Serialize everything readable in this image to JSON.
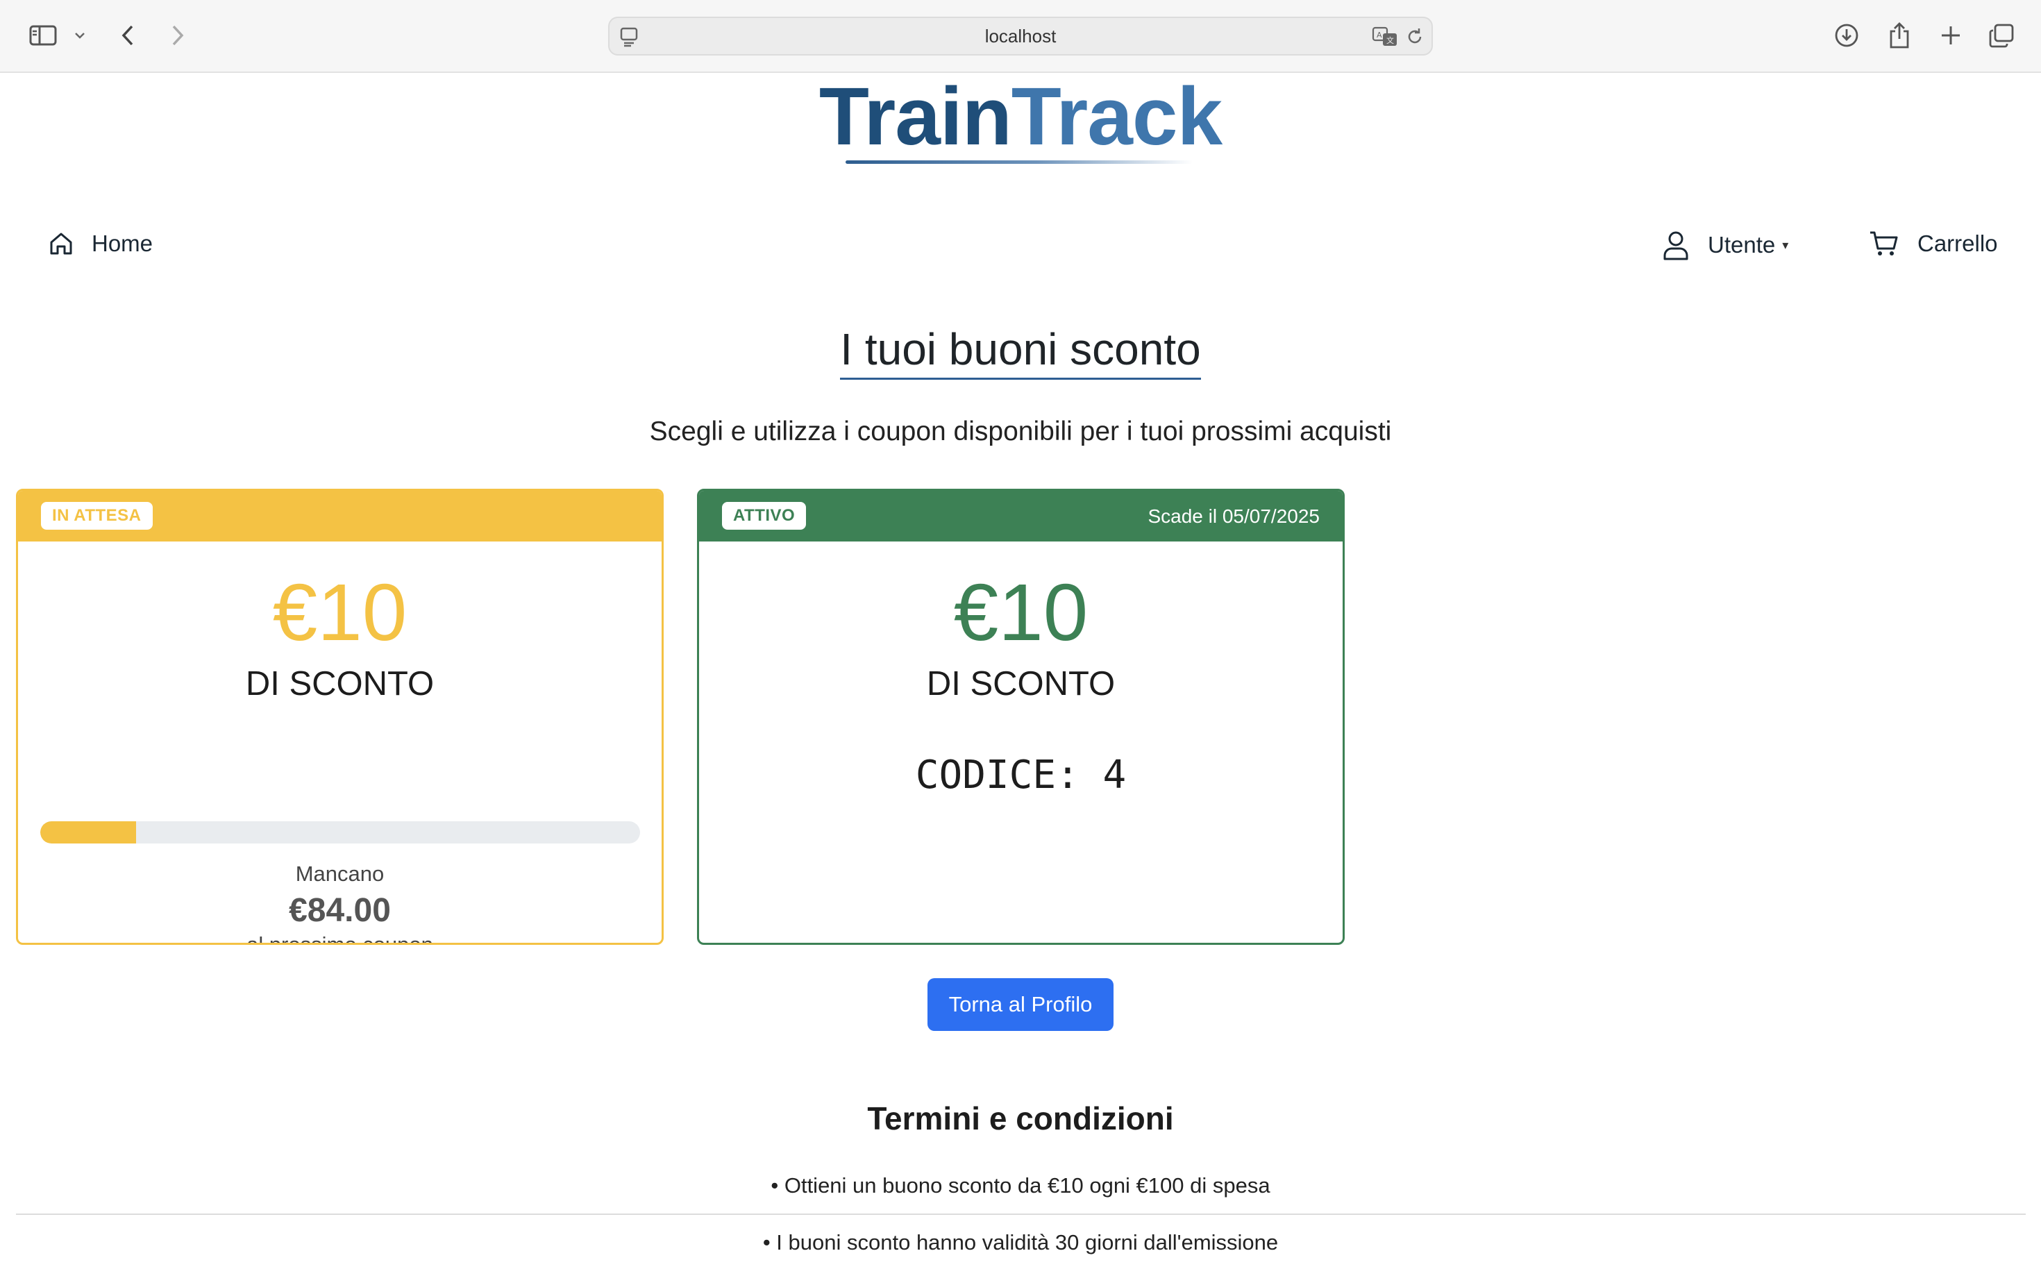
{
  "browser": {
    "url": "localhost",
    "icons": [
      "sidebar-icon",
      "chevron-down-icon",
      "back-icon",
      "forward-icon",
      "page-icon",
      "translate-icon",
      "reload-icon",
      "download-icon",
      "share-icon",
      "plus-icon",
      "tabs-icon"
    ]
  },
  "header": {
    "logo_part1": "Train",
    "logo_part2": "Track"
  },
  "nav": {
    "home_label": "Home",
    "user_label": "Utente",
    "user_caret": "▾",
    "cart_label": "Carrello"
  },
  "main": {
    "title": "I tuoi buoni sconto",
    "subtitle": "Scegli e utilizza i coupon disponibili per i tuoi prossimi acquisti"
  },
  "coupons": [
    {
      "status": "IN ATTESA",
      "amount": "€10",
      "amount_label": "DI SCONTO",
      "progress_percent": 16,
      "remaining_label": "Mancano",
      "remaining_amount": "€84.00",
      "remaining_suffix": "al prossimo coupon",
      "color": "#f4c244"
    },
    {
      "status": "ATTIVO",
      "expires": "Scade il 05/07/2025",
      "amount": "€10",
      "amount_label": "DI SCONTO",
      "code": "CODICE: 4",
      "color": "#3d8155"
    }
  ],
  "actions": {
    "back_to_profile": "Torna al Profilo"
  },
  "terms": {
    "title": "Termini e condizioni",
    "items": [
      "• Ottieni un buono sconto da €10 ogni €100 di spesa",
      "• I buoni sconto hanno validità 30 giorni dall'emissione"
    ]
  },
  "colors": {
    "primary": "#2d6ff1",
    "logo_dark": "#1f4e79",
    "logo_light": "#3f76ac"
  }
}
